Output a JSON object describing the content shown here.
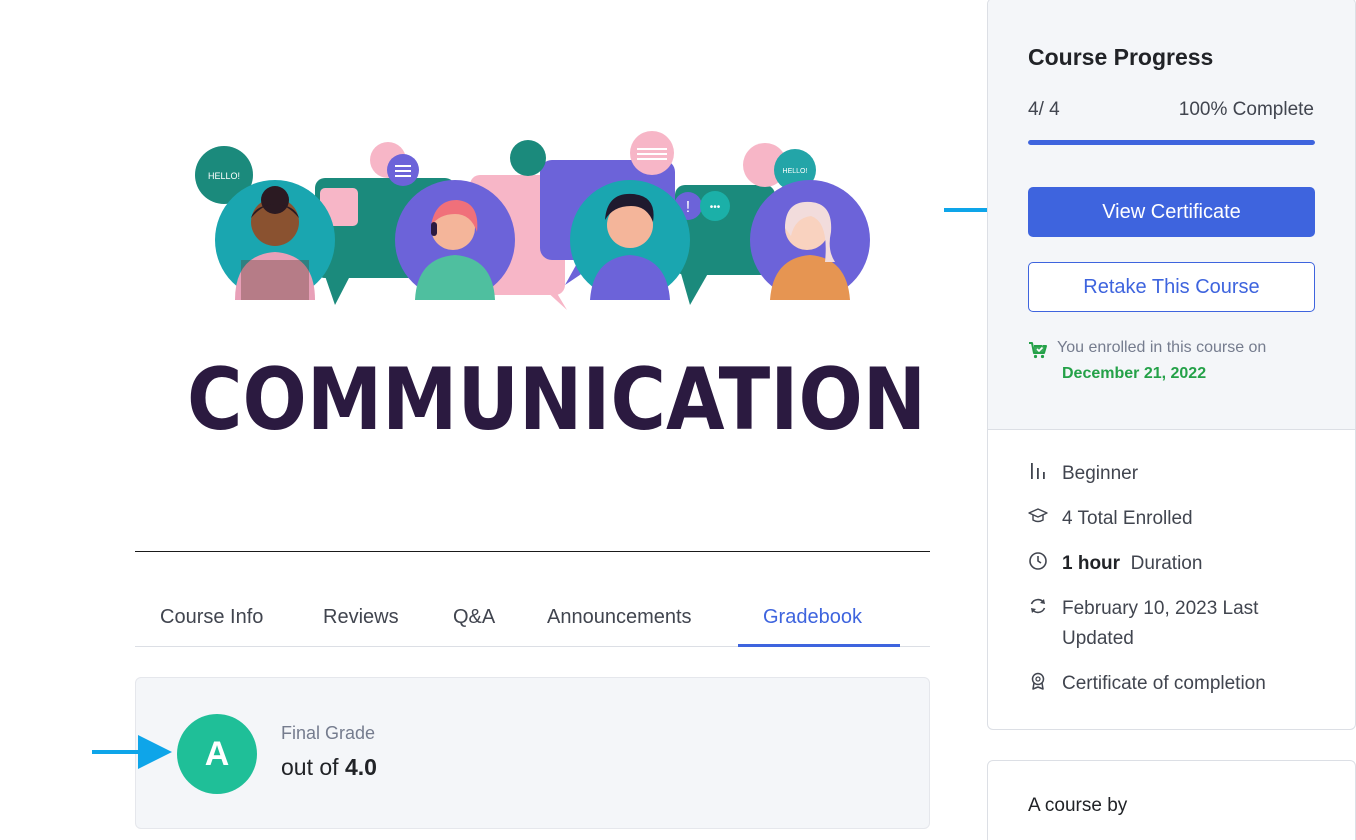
{
  "hero": {
    "title_text": "COMMUNICATION",
    "bubble_hello_left": "HELLO!",
    "bubble_hello_right": "HELLO!",
    "bubble_exclaim": "!",
    "bubble_dots": "•••"
  },
  "tabs": [
    {
      "label": "Course Info"
    },
    {
      "label": "Reviews"
    },
    {
      "label": "Q&A"
    },
    {
      "label": "Announcements"
    },
    {
      "label": "Gradebook"
    }
  ],
  "grade": {
    "letter": "A",
    "label": "Final Grade",
    "out_of_prefix": "out of",
    "out_of_value": "4.0"
  },
  "sidebar": {
    "title": "Course Progress",
    "progress_count": "4/ 4",
    "progress_percent_text": "100% Complete",
    "progress_fraction": 1.0,
    "view_certificate_label": "View Certificate",
    "retake_label": "Retake This Course",
    "enrolled_text": "You enrolled in this course on",
    "enrolled_date": "December 21, 2022",
    "meta": {
      "level": "Beginner",
      "enrolled": "4 Total Enrolled",
      "duration_value": "1 hour",
      "duration_label": "Duration",
      "updated_line1": "February 10, 2023 Last",
      "updated_line2": "Updated",
      "certificate": "Certificate of completion"
    },
    "course_by_label": "A course by"
  },
  "colors": {
    "accent": "#3e64de",
    "grade_circle": "#1fbf98",
    "enroll_date": "#24a148",
    "arrow": "#0ea5e9",
    "hero_text": "#2b1a40"
  }
}
